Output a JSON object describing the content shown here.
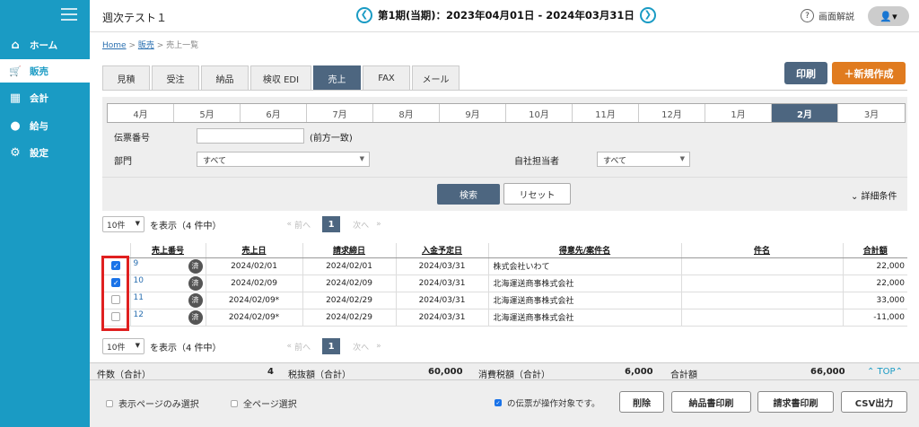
{
  "app": {
    "title": "週次テスト１"
  },
  "period": {
    "prev": "❮",
    "text": "第1期(当期)：2023年04月01日 - 2024年03月31日",
    "next": "❯"
  },
  "help": {
    "icon": "?",
    "label": "画面解説"
  },
  "user": {
    "icon": "👤▾"
  },
  "sidebar": {
    "items": [
      {
        "label": "ホーム",
        "icon": "home-icon",
        "glyph": "⌂"
      },
      {
        "label": "販売",
        "icon": "cart-icon",
        "glyph": "🛒"
      },
      {
        "label": "会計",
        "icon": "calculator-icon",
        "glyph": "▦"
      },
      {
        "label": "給与",
        "icon": "money-bag-icon",
        "glyph": "●"
      },
      {
        "label": "設定",
        "icon": "gear-icon",
        "glyph": "⚙"
      }
    ]
  },
  "breadcrumb": {
    "home": "Home",
    "sep1": " > ",
    "sales": "販売",
    "sep2": " > ",
    "current": "売上一覧"
  },
  "tabs": [
    "見積",
    "受注",
    "納品",
    "検収 EDI",
    "売上",
    "FAX",
    "メール"
  ],
  "actions": {
    "print": "印刷",
    "new": "＋新規作成"
  },
  "months": [
    "4月",
    "5月",
    "6月",
    "7月",
    "8月",
    "9月",
    "10月",
    "11月",
    "12月",
    "1月",
    "2月",
    "3月"
  ],
  "search": {
    "slip_label": "伝票番号",
    "slip_value": "",
    "slip_hint": "(前方一致)",
    "dept_label": "部門",
    "dept_value": "すべて",
    "staff_label": "自社担当者",
    "staff_value": "すべて",
    "search_btn": "検索",
    "reset_btn": "リセット",
    "detail": "⌄ 詳細条件"
  },
  "pager": {
    "per_page": "10件",
    "text": "を表示（4 件中）",
    "first": "«",
    "prev": "前へ",
    "page": "1",
    "next": "次へ",
    "last": "»"
  },
  "table": {
    "headers": [
      "売上番号",
      "売上日",
      "請求締日",
      "入金予定日",
      "得意先/案件名",
      "件名",
      "合計額"
    ],
    "rows": [
      {
        "checked": true,
        "no": "9",
        "status": "済",
        "date": "2024/02/01",
        "close": "2024/02/01",
        "due": "2024/03/31",
        "customer": "株式会社いわて",
        "subject": "",
        "amount": "22,000"
      },
      {
        "checked": true,
        "no": "10",
        "status": "済",
        "date": "2024/02/09",
        "close": "2024/02/09",
        "due": "2024/03/31",
        "customer": "北海運送商事株式会社",
        "subject": "",
        "amount": "22,000"
      },
      {
        "checked": false,
        "no": "11",
        "status": "済",
        "date": "2024/02/09*",
        "close": "2024/02/29",
        "due": "2024/03/31",
        "customer": "北海運送商事株式会社",
        "subject": "",
        "amount": "33,000"
      },
      {
        "checked": false,
        "no": "12",
        "status": "済",
        "date": "2024/02/09*",
        "close": "2024/02/29",
        "due": "2024/03/31",
        "customer": "北海運送商事株式会社",
        "subject": "",
        "amount": "-11,000"
      }
    ]
  },
  "totals": {
    "count_label": "件数（合計）",
    "count": "4",
    "net_label": "税抜額（合計）",
    "net": "60,000",
    "tax_label": "消費税額（合計）",
    "tax": "6,000",
    "total_label": "合計額",
    "total": "66,000",
    "top": "⌃ TOP⌃"
  },
  "footer": {
    "page_only": "表示ページのみ選択",
    "all_pages": "全ページ選択",
    "target_text": "の伝票が操作対象です。",
    "delete": "削除",
    "delivery_print": "納品書印刷",
    "invoice_print": "請求書印刷",
    "csv": "CSV出力"
  },
  "colors": {
    "sidebar": "#1a9bc4",
    "accent": "#4d6680",
    "new_button": "#e07b1f",
    "highlight": "#e02020"
  }
}
